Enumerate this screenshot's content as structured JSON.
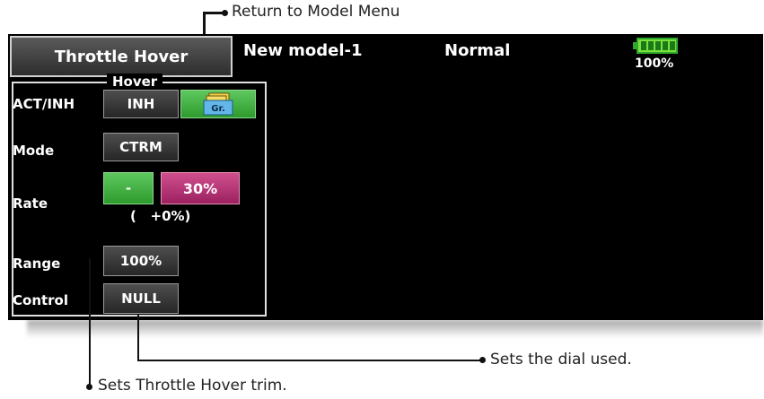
{
  "callouts": {
    "return_menu": "Return to Model Menu",
    "dial_used": "Sets the dial used.",
    "hover_trim": "Sets Throttle Hover trim."
  },
  "header": {
    "title": "Throttle Hover",
    "model_name": "New model-1",
    "condition": "Normal",
    "battery_percent": "100%"
  },
  "group": {
    "title": "Hover",
    "rows": {
      "act_inh": {
        "label": "ACT/INH",
        "value": "INH",
        "group_badge": "Gr."
      },
      "mode": {
        "label": "Mode",
        "value": "CTRM"
      },
      "rate": {
        "label": "Rate",
        "left_value": "-",
        "right_value": "30%",
        "trim_readout": "(   +0%)"
      },
      "range": {
        "label": "Range",
        "value": "100%"
      },
      "control": {
        "label": "Control",
        "value": "NULL"
      }
    }
  },
  "colors": {
    "screen_bg": "#000000",
    "accent_green": "#2e9b2e",
    "accent_pink": "#b8307a",
    "battery_green": "#7be03a"
  },
  "icons": {
    "group_icon": "group-folder-icon",
    "battery_icon": "battery-icon"
  }
}
